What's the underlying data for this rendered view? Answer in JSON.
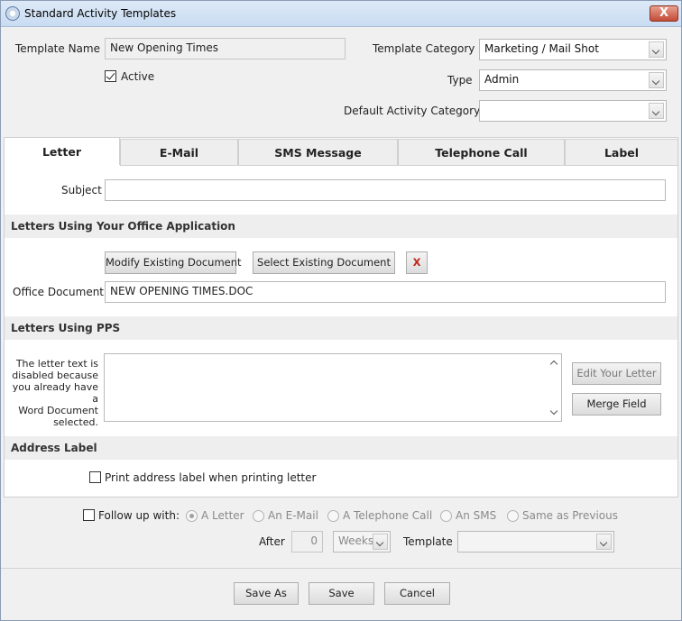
{
  "window": {
    "title": "Standard Activity Templates",
    "close_label": "X"
  },
  "form": {
    "template_name_label": "Template Name",
    "template_name_value": "New Opening Times",
    "active_label": "Active",
    "active_checked": true,
    "template_category_label": "Template Category",
    "template_category_value": "Marketing / Mail Shot",
    "type_label": "Type",
    "type_value": "Admin",
    "default_activity_category_label": "Default Activity Category",
    "default_activity_category_value": ""
  },
  "tabs": [
    {
      "label": "Letter",
      "active": true
    },
    {
      "label": "E-Mail",
      "active": false
    },
    {
      "label": "SMS Message",
      "active": false
    },
    {
      "label": "Telephone Call",
      "active": false
    },
    {
      "label": "Label",
      "active": false
    }
  ],
  "letter": {
    "subject_label": "Subject",
    "subject_value": "",
    "office_section_title": "Letters Using Your Office Application",
    "modify_button": "Modify Existing Document",
    "select_button": "Select Existing Document",
    "remove_button": "X",
    "office_document_label": "Office Document",
    "office_document_value": "NEW OPENING TIMES.DOC",
    "pps_section_title": "Letters Using PPS",
    "pps_note_lines": [
      "The letter text is",
      "disabled because",
      "you already have a",
      "Word Document",
      "selected."
    ],
    "edit_letter_button": "Edit Your Letter",
    "merge_field_button": "Merge Field",
    "address_section_title": "Address Label",
    "print_address_label": "Print address label when printing letter",
    "print_address_checked": false
  },
  "followup": {
    "label": "Follow up with:",
    "checked": false,
    "options": [
      {
        "label": "A Letter",
        "selected": true
      },
      {
        "label": "An E-Mail",
        "selected": false
      },
      {
        "label": "A Telephone Call",
        "selected": false
      },
      {
        "label": "An SMS",
        "selected": false
      },
      {
        "label": "Same as Previous",
        "selected": false
      }
    ],
    "after_label": "After",
    "after_value": "0",
    "unit_value": "Weeks",
    "template_label": "Template",
    "template_value": ""
  },
  "footer": {
    "save_as_label": "Save As",
    "save_label": "Save",
    "cancel_label": "Cancel"
  },
  "colors": {
    "title_bar": "#cfe0f4",
    "close_button": "#c9503b",
    "remove_x": "#c0281d"
  }
}
